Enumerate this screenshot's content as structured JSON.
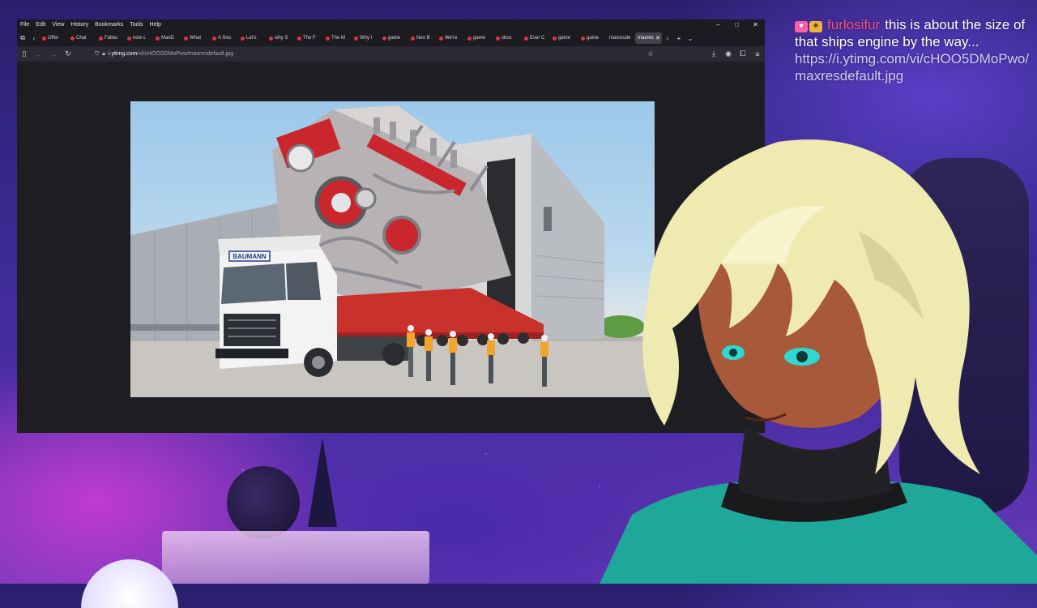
{
  "menu": [
    "File",
    "Edit",
    "View",
    "History",
    "Bookmarks",
    "Tools",
    "Help"
  ],
  "window_controls": [
    "–",
    "□",
    "✕"
  ],
  "tabs": [
    {
      "label": "Offer"
    },
    {
      "label": "Chat"
    },
    {
      "label": "Fallou"
    },
    {
      "label": "how c"
    },
    {
      "label": "MaxD"
    },
    {
      "label": "What"
    },
    {
      "label": "A Sno"
    },
    {
      "label": "Let's"
    },
    {
      "label": "why S"
    },
    {
      "label": "The F"
    },
    {
      "label": "The M"
    },
    {
      "label": "Why I"
    },
    {
      "label": "game"
    },
    {
      "label": "Neo B"
    },
    {
      "label": "We're"
    },
    {
      "label": "game"
    },
    {
      "label": "xbox"
    },
    {
      "label": "Ever C"
    },
    {
      "label": "game"
    },
    {
      "label": "game"
    },
    {
      "label": "maxresde"
    }
  ],
  "active_tab": {
    "label": "maxres"
  },
  "address": {
    "host": "i.ytimg.com",
    "path": "/vi/cHOOSDMoPwo/maxresdefault.jpg"
  },
  "image": {
    "truck_label": "BAUMANN"
  },
  "chat": {
    "username": "furlosifur",
    "message": "this is about the size of that ships engine by the way...",
    "url": "https://i.ytimg.com/vi/cHOO5DMoPwo/maxresdefault.jpg"
  },
  "colors": {
    "username": "#ff4d7a",
    "tab_favicon": "#e5323b"
  },
  "icons": [
    "sidebar-icon",
    "back-icon",
    "forward-icon",
    "reload-icon",
    "shield-icon",
    "lock-icon",
    "star-icon",
    "download-icon",
    "account-icon",
    "extensions-icon",
    "menu-icon"
  ]
}
